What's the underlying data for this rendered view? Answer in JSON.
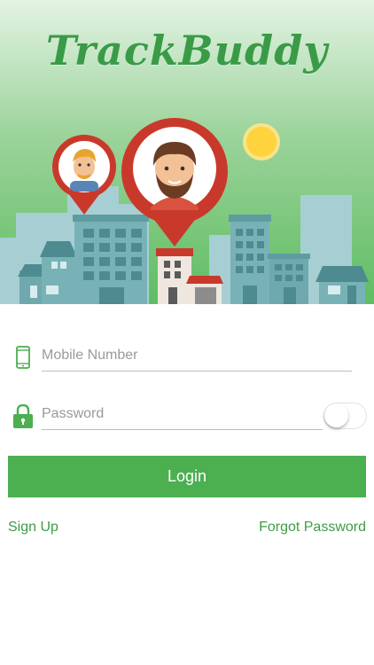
{
  "app": {
    "logo_text": "TrackBuddy"
  },
  "form": {
    "mobile_placeholder": "Mobile Number",
    "password_placeholder": "Password",
    "show_password": false,
    "login_label": "Login",
    "signup_label": "Sign Up",
    "forgot_label": "Forgot Password"
  },
  "colors": {
    "brand_green": "#4caf50",
    "link_green": "#3c9d46",
    "pin_red": "#c9392b",
    "sun_yellow": "#ffd33d"
  },
  "icons": {
    "mobile": "phone-icon",
    "password": "lock-icon"
  }
}
